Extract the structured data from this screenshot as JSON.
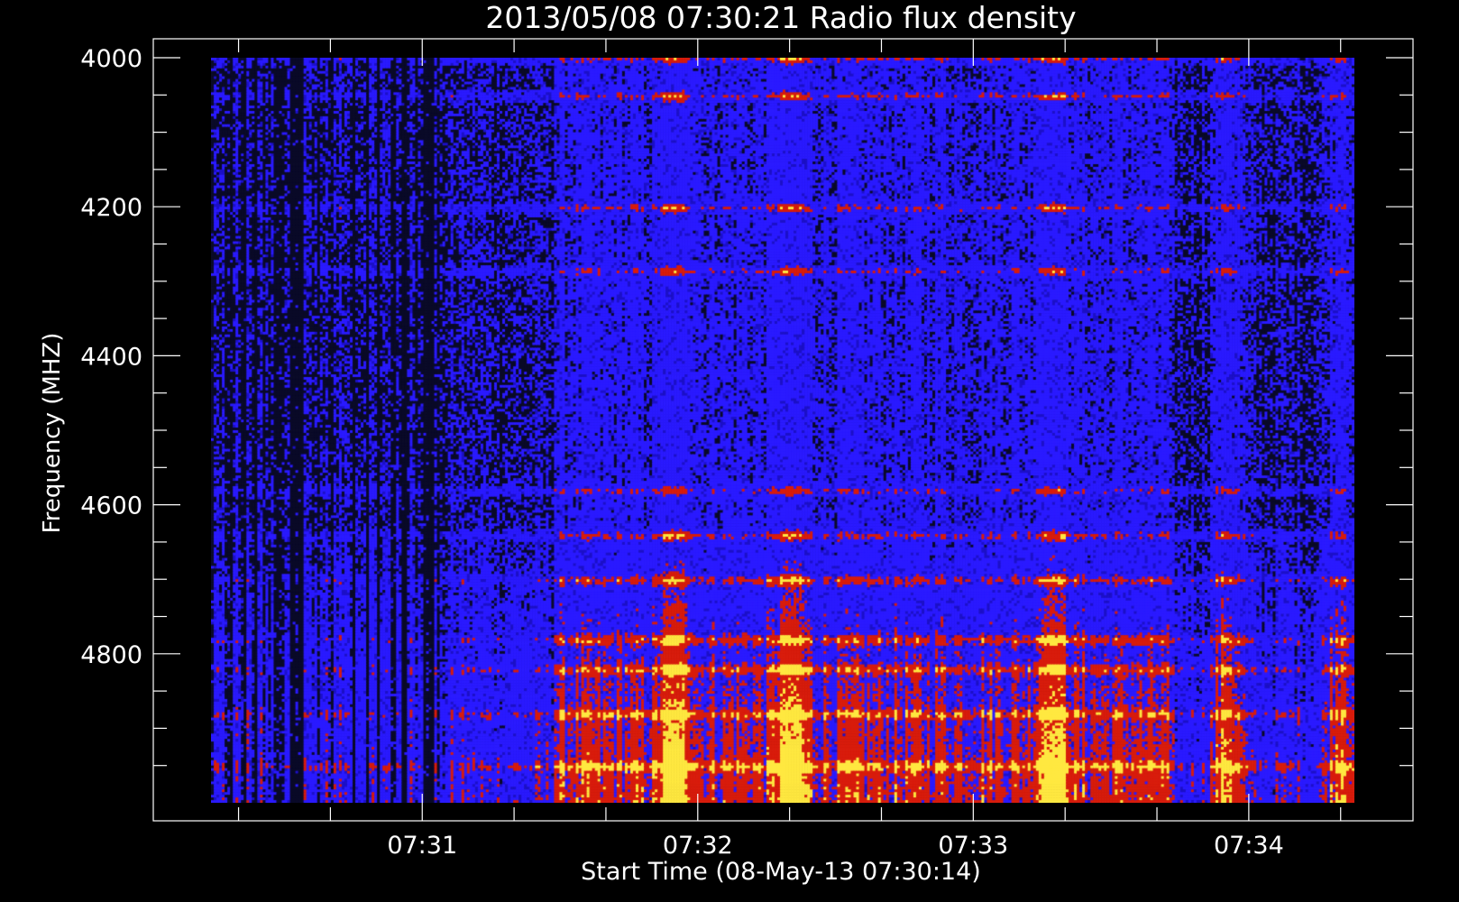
{
  "chart_data": {
    "type": "heatmap",
    "title": "2013/05/08 07:30:21 Radio flux density",
    "xlabel": "Start Time (08-May-13 07:30:14)",
    "ylabel": "Frequency (MHZ)",
    "x_ticks": [
      "07:31",
      "07:32",
      "07:33",
      "07:34"
    ],
    "y_ticks": [
      "4000",
      "4200",
      "4400",
      "4600",
      "4800"
    ],
    "x_range": [
      "07:30:14",
      "07:34:23"
    ],
    "ylim": [
      4000,
      5000
    ],
    "y_inverted": true,
    "colormap": {
      "low": "#0a0a28",
      "mid": "#2a1aff",
      "high": "#d81c0c",
      "peak": "#ffe840"
    },
    "frequency_bands_mhz": [
      4000,
      4050,
      4200,
      4285,
      4580,
      4640,
      4700,
      4780,
      4820,
      4880,
      4950
    ],
    "burst_times": [
      "07:31:55",
      "07:32:20",
      "07:33:17",
      "07:33:55",
      "07:34:20"
    ]
  }
}
